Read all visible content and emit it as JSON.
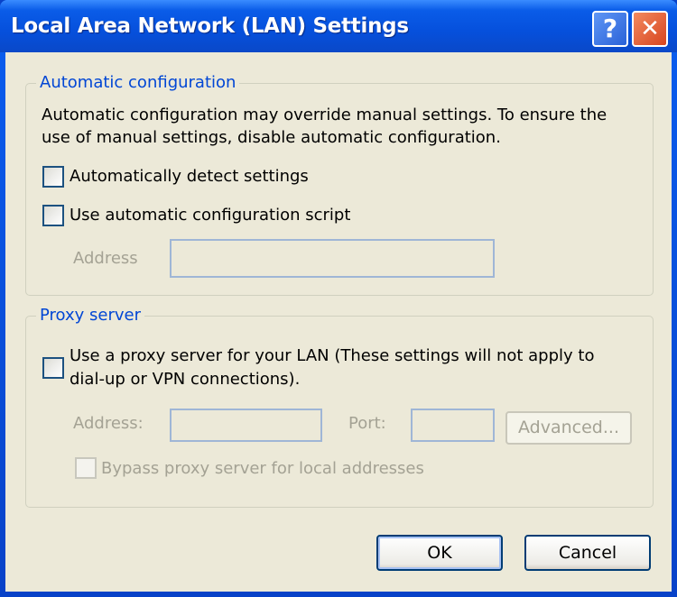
{
  "window": {
    "title": "Local Area Network (LAN) Settings",
    "help_glyph": "?",
    "close_glyph": "✕"
  },
  "auto_config": {
    "legend": "Automatic configuration",
    "description_line1": "Automatic configuration may override manual settings.  To ensure the",
    "description_line2": "use of manual settings, disable automatic configuration.",
    "detect_label": "Automatically detect settings",
    "detect_checked": false,
    "script_label": "Use automatic configuration script",
    "script_checked": false,
    "address_label": "Address",
    "address_value": ""
  },
  "proxy": {
    "legend": "Proxy server",
    "use_proxy_line1": "Use a proxy server for your LAN (These settings will not apply to",
    "use_proxy_line2": "dial-up or VPN connections).",
    "use_proxy_checked": false,
    "address_label": "Address:",
    "address_value": "",
    "port_label": "Port:",
    "port_value": "",
    "advanced_label": "Advanced...",
    "bypass_label": "Bypass proxy server for local addresses",
    "bypass_checked": false
  },
  "buttons": {
    "ok": "OK",
    "cancel": "Cancel"
  }
}
